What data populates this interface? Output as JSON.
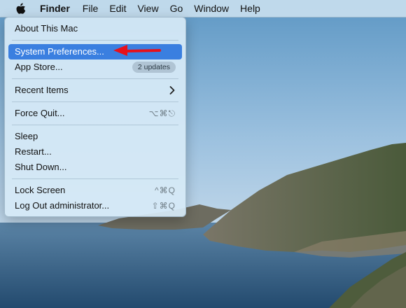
{
  "menubar": {
    "apple_icon": "apple-icon",
    "items": [
      "Finder",
      "File",
      "Edit",
      "View",
      "Go",
      "Window",
      "Help"
    ]
  },
  "apple_menu": {
    "about": "About This Mac",
    "system_preferences": "System Preferences...",
    "app_store": "App Store...",
    "app_store_badge": "2 updates",
    "recent_items": "Recent Items",
    "force_quit": "Force Quit...",
    "force_quit_shortcut": "⌥⌘⎋",
    "sleep": "Sleep",
    "restart": "Restart...",
    "shut_down": "Shut Down...",
    "lock_screen": "Lock Screen",
    "lock_screen_shortcut": "^⌘Q",
    "log_out": "Log Out administrator...",
    "log_out_shortcut": "⇧⌘Q"
  },
  "annotation": {
    "arrow_color": "#e8101a"
  },
  "colors": {
    "highlight": "#3a7fe0"
  }
}
